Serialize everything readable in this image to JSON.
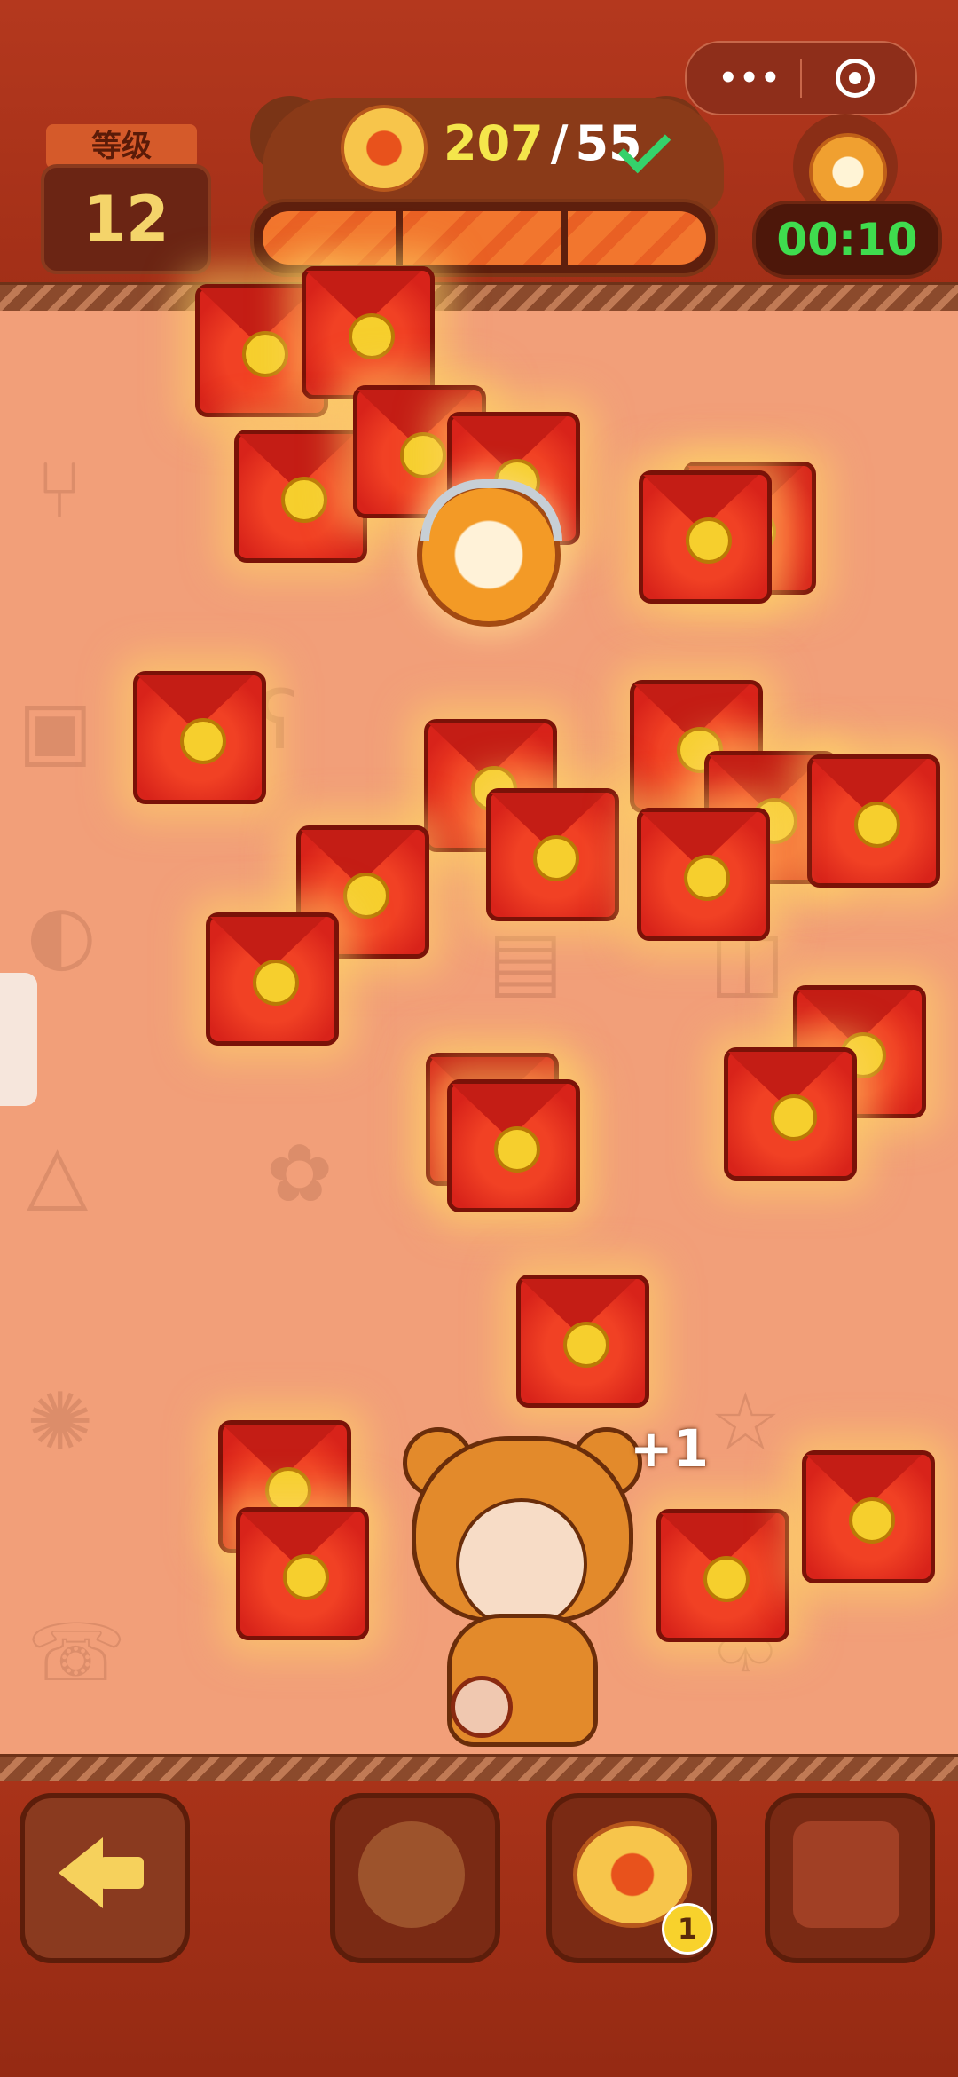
{
  "header": {
    "level_label": "等级",
    "level_value": "12",
    "score_current": "207",
    "score_separator": "/",
    "score_goal": "55",
    "timer": "00:10",
    "progress_fraction": 1.0
  },
  "miniprogram_menu": {
    "more_icon": "more-dots-icon",
    "close_icon": "target-circle-icon"
  },
  "field": {
    "floating_text": "+1"
  },
  "bottom_bar": {
    "back_icon": "back-arrow-icon",
    "items": [
      {
        "name": "shield-powerup",
        "icon": "shield-icon"
      },
      {
        "name": "coin-powerup",
        "icon": "coin-icon",
        "count": "1"
      },
      {
        "name": "red-envelope-powerup",
        "icon": "red-envelope-icon"
      }
    ]
  },
  "colors": {
    "header_bg": "#b4381e",
    "field_bg": "#f29f79",
    "timer_text": "#3fdc4e",
    "score_current": "#f4e64b",
    "envelope_red": "#d8231a",
    "coin_gold": "#f6cf2d"
  }
}
